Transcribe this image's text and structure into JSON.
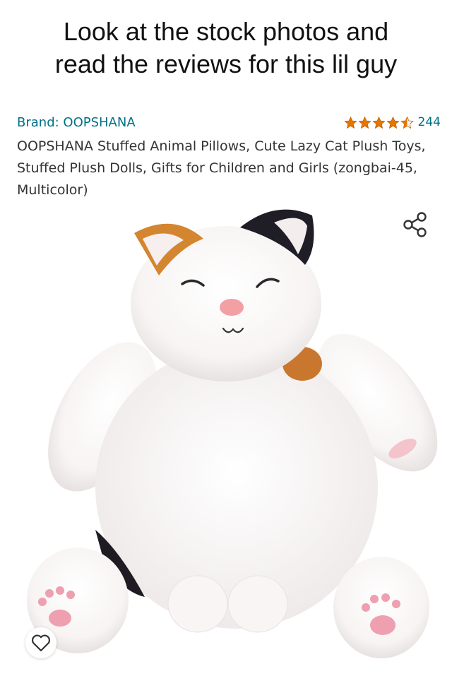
{
  "caption": {
    "line1": "Look at the stock photos and",
    "line2": "read the reviews for this lil guy"
  },
  "product": {
    "brand": "Brand: OOPSHANA",
    "rating_stars": 4.5,
    "rating_count": "244",
    "title": "OOPSHANA Stuffed Animal Pillows, Cute Lazy Cat Plush Toys, Stuffed Plush Dolls, Gifts for Children and Girls (zongbai-45, Multicolor)"
  },
  "icons": {
    "share": "share-icon",
    "wishlist": "heart-icon",
    "star": "star-icon"
  },
  "colors": {
    "link": "#007185",
    "star": "#e77600",
    "title_text": "#333333"
  }
}
